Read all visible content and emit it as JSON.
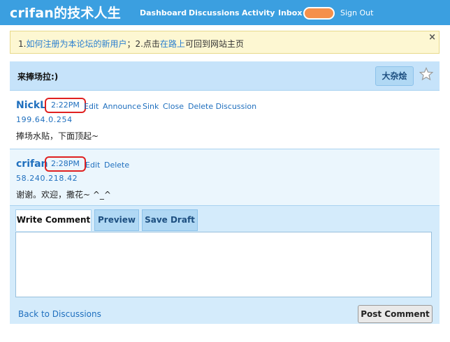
{
  "header": {
    "site_title": "crifan的技术人生",
    "nav": [
      "Dashboard",
      "Discussions",
      "Activity",
      "Inbox"
    ],
    "sign_out": "Sign Out",
    "inbox_badge_color": "#f5904c"
  },
  "notice": {
    "prefix": "1.",
    "link1": "如何注册为本论坛的新用户",
    "middle": "；2.点击",
    "link2": "在路上",
    "suffix": "可回到网站主页",
    "close": "×"
  },
  "discussion": {
    "title": "来捧场拉:)",
    "category_button": "大杂烩"
  },
  "comments": [
    {
      "author": "NickL",
      "time": "2:22PM",
      "actions": [
        "Edit",
        "Announce",
        "Sink",
        "Close",
        "Delete Discussion"
      ],
      "ip": "199.64.0.254",
      "body": "捧场水贴，下面顶起~"
    },
    {
      "author": "crifan",
      "time": "2:28PM",
      "actions": [
        "Edit",
        "Delete"
      ],
      "ip": "58.240.218.42",
      "body": "谢谢。欢迎，撒花~ ^_^"
    }
  ],
  "editor": {
    "tabs": [
      "Write Comment",
      "Preview",
      "Save Draft"
    ],
    "value": "",
    "back_link": "Back to Discussions",
    "post_button": "Post Comment"
  }
}
